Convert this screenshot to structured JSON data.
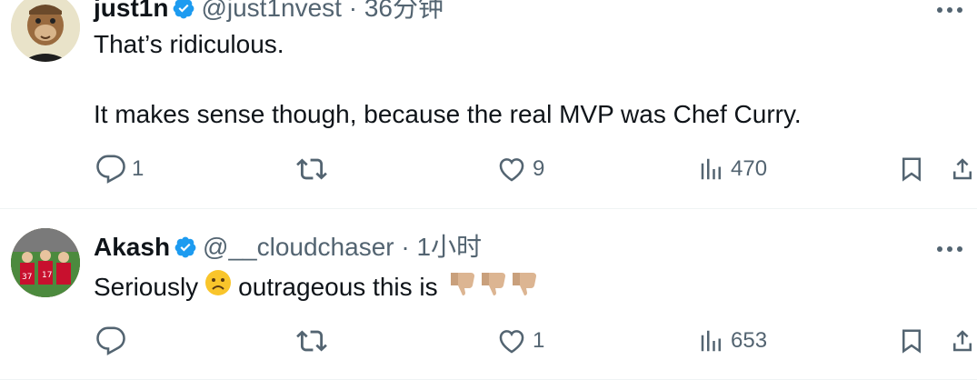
{
  "tweets": [
    {
      "display_name": "just1n",
      "handle": "@just1nvest",
      "separator": "·",
      "timestamp": "36分钟",
      "text_lines": [
        "That’s ridiculous.",
        "It makes sense though, because the real MVP was Chef Curry."
      ],
      "reply_count": "1",
      "retweet_count": "",
      "like_count": "9",
      "view_count": "470",
      "avatar_icon": "bored-ape-avatar"
    },
    {
      "display_name": "Akash",
      "handle": "@__cloudchaser",
      "separator": "·",
      "timestamp": "1小时",
      "text_before_emoji": "Seriously",
      "text_after_emoji": "outrageous this is",
      "emojis": [
        "frowning-face-emoji",
        "thumbs-down-emoji",
        "thumbs-down-emoji",
        "thumbs-down-emoji"
      ],
      "reply_count": "",
      "retweet_count": "",
      "like_count": "1",
      "view_count": "653",
      "avatar_icon": "football-team-avatar"
    }
  ],
  "colors": {
    "text": "#0f1419",
    "secondary": "#536471",
    "verified_blue": "#1d9bf0",
    "divider": "#eff3f4"
  }
}
